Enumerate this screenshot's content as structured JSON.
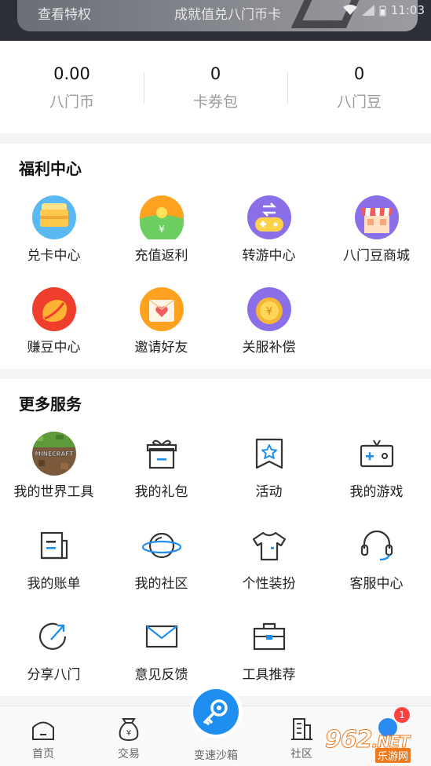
{
  "banner": {
    "left_text": "查看特权",
    "mid_text": "成就值兑八门币卡",
    "time": "11:03"
  },
  "stats": [
    {
      "value": "0.00",
      "label": "八门币"
    },
    {
      "value": "0",
      "label": "卡券包"
    },
    {
      "value": "0",
      "label": "八门豆"
    }
  ],
  "welfare": {
    "title": "福利中心",
    "items": [
      {
        "label": "兑卡中心",
        "icon": "card-exchange-icon"
      },
      {
        "label": "充值返利",
        "icon": "recharge-rebate-icon"
      },
      {
        "label": "转游中心",
        "icon": "game-transfer-icon"
      },
      {
        "label": "八门豆商城",
        "icon": "bean-mall-icon"
      },
      {
        "label": "赚豆中心",
        "icon": "earn-beans-icon"
      },
      {
        "label": "邀请好友",
        "icon": "invite-friends-icon"
      },
      {
        "label": "关服补偿",
        "icon": "shutdown-compensation-icon"
      }
    ]
  },
  "more": {
    "title": "更多服务",
    "items": [
      {
        "label": "我的世界工具",
        "icon": "minecraft-icon",
        "icon_text": "MINECRAFT"
      },
      {
        "label": "我的礼包",
        "icon": "gift-icon"
      },
      {
        "label": "活动",
        "icon": "activity-star-icon"
      },
      {
        "label": "我的游戏",
        "icon": "gamepad-icon"
      },
      {
        "label": "我的账单",
        "icon": "bill-icon"
      },
      {
        "label": "我的社区",
        "icon": "planet-icon"
      },
      {
        "label": "个性装扮",
        "icon": "tshirt-icon"
      },
      {
        "label": "客服中心",
        "icon": "headset-icon"
      },
      {
        "label": "分享八门",
        "icon": "share-icon"
      },
      {
        "label": "意见反馈",
        "icon": "mail-icon"
      },
      {
        "label": "工具推荐",
        "icon": "toolbox-icon"
      }
    ]
  },
  "nav": {
    "home": "首页",
    "trade": "交易",
    "center": "变速沙箱",
    "community": "社区",
    "badge": "1",
    "trade_icon_text": "¥"
  },
  "watermark": {
    "brand": "962",
    "net": ".NET",
    "sub": "乐游网"
  },
  "colors": {
    "accent": "#1e8ff0",
    "badge": "#ff4141"
  }
}
